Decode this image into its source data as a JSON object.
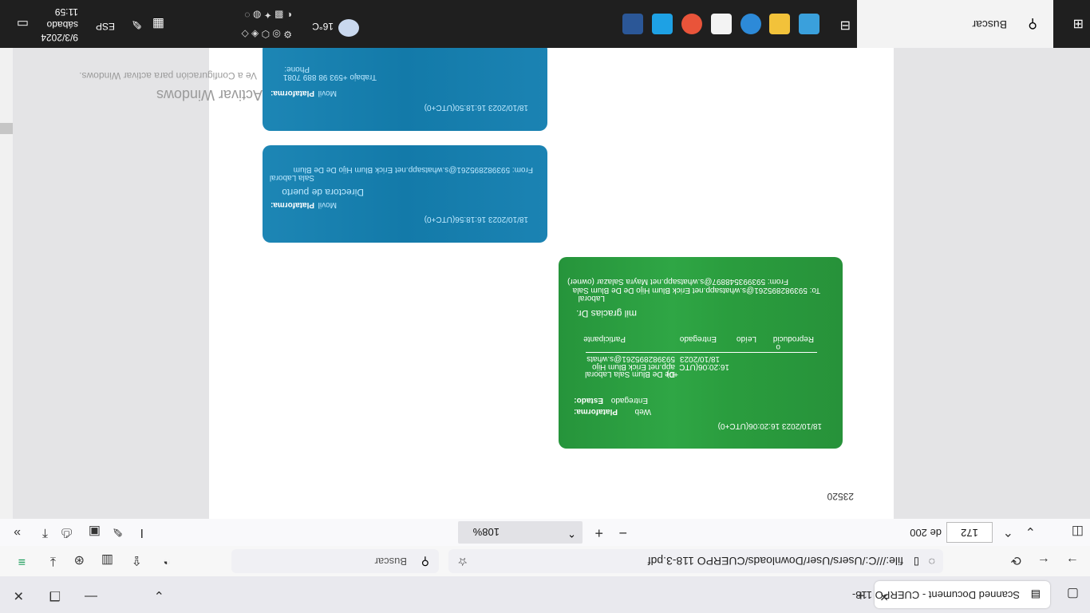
{
  "browser": {
    "tab_title": "Scanned Document - CUERPO 118-",
    "url": "file:///C:/Users/User/Downloads/CUERPO 118-3.pdf",
    "search_placeholder": "Buscar"
  },
  "pdf_toolbar": {
    "page_current": "172",
    "page_count": "de 200",
    "zoom": "108%"
  },
  "document": {
    "page_number": "23520",
    "messages": [
      {
        "from": "From: 593993548897@s.whatsapp.net Mayra Salazar (owner)",
        "to": "To: 593982895261@s.whatsapp.net Erick Blum Hijo De De Blum Sala",
        "to_cont": "Laboral",
        "body": "mil gracias Dr.",
        "table_headers": [
          "Participante",
          "Entregado",
          "Leído",
          "Reproducid",
          "o"
        ],
        "row_participant": [
          "593982895261@s.whats",
          "app.net Erick Blum Hijo",
          "De De Blum Sala Laboral"
        ],
        "row_delivered": [
          "18/10/2023",
          "16:20:06(UTC",
          "+0)"
        ],
        "status_label": "Estado:",
        "status_value": "Entregado",
        "platform_label": "Plataforma:",
        "platform_value": "Web",
        "timestamp": "18/10/2023 16:20:06(UTC+0)"
      },
      {
        "from": "From: 593982895261@s.whatsapp.net Erick Blum Hijo De De Blum",
        "from_cont": "Sala Laboral",
        "body": "Directora de puerto",
        "platform_label": "Plataforma:",
        "platform_value": "Movil",
        "timestamp": "18/10/2023 16:18:56(UTC+0)"
      },
      {
        "phone_label": "Phone:",
        "phone_value": "Trabajo +593 98 889 7081",
        "platform_label": "Plataforma:",
        "platform_value": "Movil",
        "timestamp": "18/10/2023 16:18:50(UTC+0)"
      }
    ],
    "watermark_line1": "Activar Windows",
    "watermark_line2": "Ve a Configuración para activar Windows."
  },
  "taskbar": {
    "search_label": "Buscar",
    "weather": "16°C",
    "language": "ESP",
    "time": "11:59",
    "day": "sábado",
    "date": "9/3/2024"
  },
  "colors": {
    "bubble_green": "#2a9d3e",
    "bubble_blue": "#137aa9",
    "taskbar": "#1f1f1f"
  }
}
